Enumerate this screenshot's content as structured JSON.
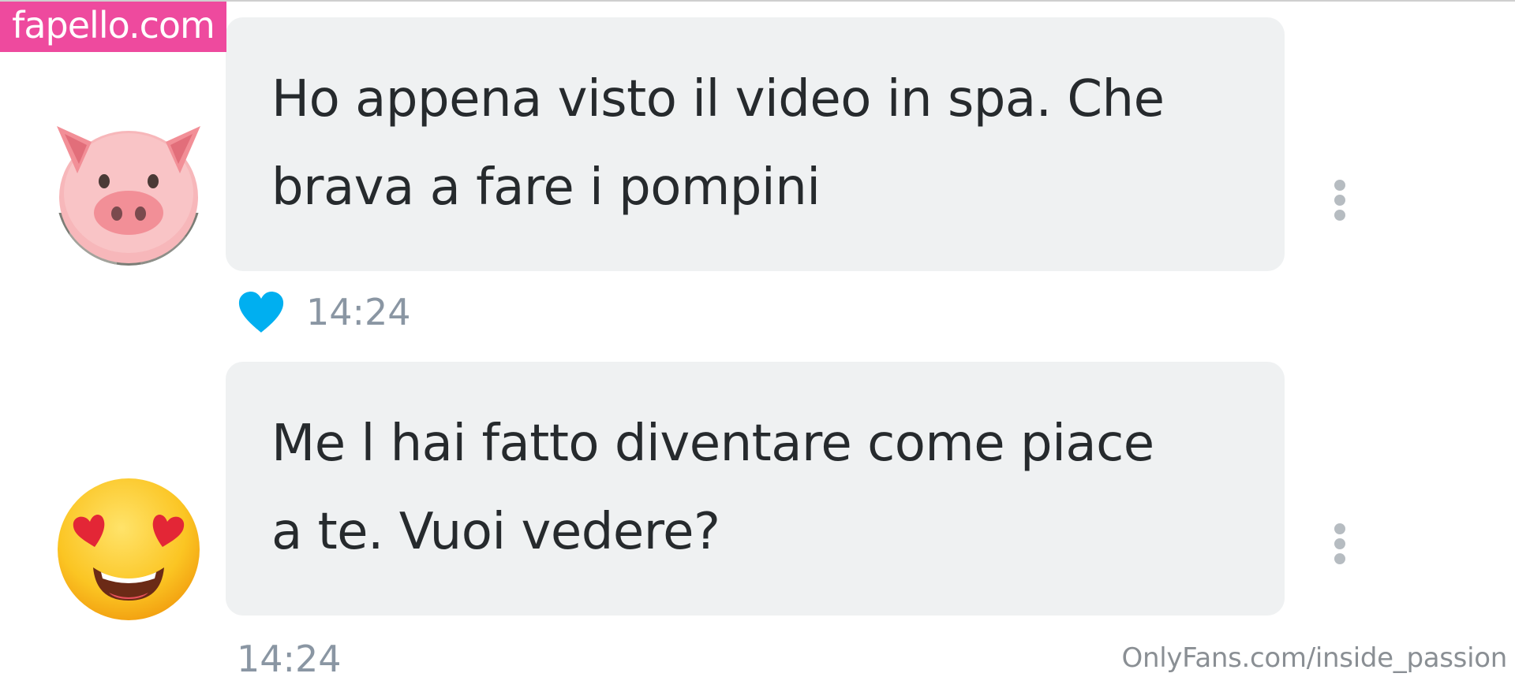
{
  "watermark_top": "fapello.com",
  "watermark_bottom": "OnlyFans.com/inside_passion",
  "colors": {
    "watermark_bg": "#ee4a9e",
    "bubble_bg": "#eff1f2",
    "heart": "#00aff0",
    "time_text": "#8a96a3"
  },
  "messages": [
    {
      "avatar_icon": "pig-face-emoji-icon",
      "line1": "Ho appena visto il video in spa. Che",
      "line2": "brava a fare i pompini",
      "liked": true,
      "time": "14:24"
    },
    {
      "avatar_icon": "heart-eyes-emoji-icon",
      "line1": "Me l hai fatto diventare come piace",
      "line2": "a te. Vuoi vedere?",
      "liked": false,
      "time": "14:24"
    }
  ]
}
